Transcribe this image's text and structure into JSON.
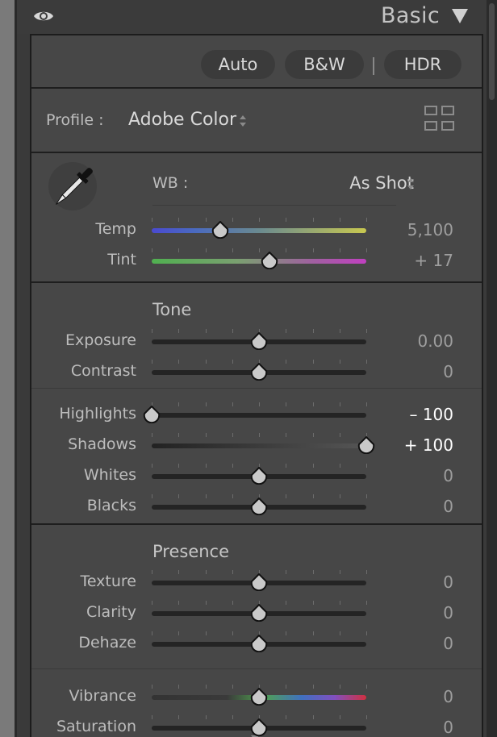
{
  "panel": {
    "title": "Basic"
  },
  "buttons": {
    "auto": "Auto",
    "bw": "B&W",
    "hdr": "HDR"
  },
  "profile": {
    "label": "Profile :",
    "value": "Adobe Color"
  },
  "wb": {
    "label": "WB :",
    "value": "As Shot"
  },
  "colors": {
    "accent_white": "#ffffff",
    "panel_bg": "#474747",
    "track": "#242424"
  },
  "sliders": {
    "temp": {
      "label": "Temp",
      "value": "5,100",
      "position": 0.32
    },
    "tint": {
      "label": "Tint",
      "value": "+ 17",
      "position": 0.55
    },
    "exposure": {
      "label": "Exposure",
      "value": "0.00",
      "position": 0.5
    },
    "contrast": {
      "label": "Contrast",
      "value": "0",
      "position": 0.5
    },
    "highlights": {
      "label": "Highlights",
      "value": "– 100",
      "position": 0.0
    },
    "shadows": {
      "label": "Shadows",
      "value": "+ 100",
      "position": 1.0
    },
    "whites": {
      "label": "Whites",
      "value": "0",
      "position": 0.5
    },
    "blacks": {
      "label": "Blacks",
      "value": "0",
      "position": 0.5
    },
    "texture": {
      "label": "Texture",
      "value": "0",
      "position": 0.5
    },
    "clarity": {
      "label": "Clarity",
      "value": "0",
      "position": 0.5
    },
    "dehaze": {
      "label": "Dehaze",
      "value": "0",
      "position": 0.5
    },
    "vibrance": {
      "label": "Vibrance",
      "value": "0",
      "position": 0.5
    },
    "saturation": {
      "label": "Saturation",
      "value": "0",
      "position": 0.5
    }
  },
  "sections": {
    "tone": "Tone",
    "presence": "Presence"
  }
}
